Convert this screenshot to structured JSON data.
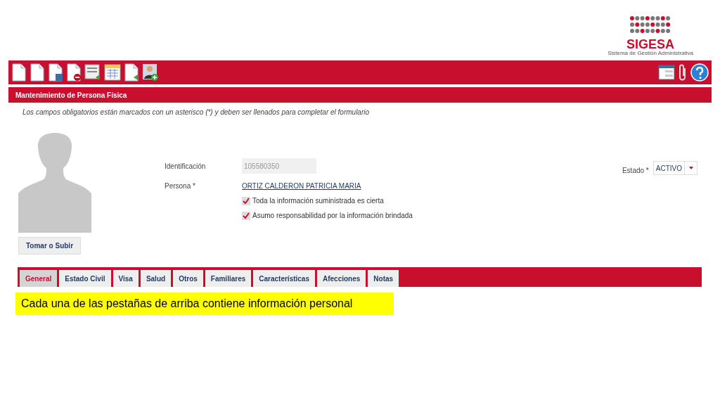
{
  "logo": {
    "name": "SIGESA",
    "subtitle": "Sistema de Gestión Administrativa"
  },
  "panel_title": "Mantenimiento de Persona Física",
  "instructions": "Los campos obligatorios están marcados con un asterisco (*) y deben ser llenados para completar el formulario",
  "photo_button": "Tomar o Subir",
  "form": {
    "id_label": "Identificación",
    "id_value": "105580350",
    "persona_label": "Persona *",
    "persona_link": "ORTIZ CALDERON PATRICIA MARIA",
    "checks": [
      {
        "label": "Toda la información suministrada es cierta",
        "checked": true
      },
      {
        "label": "Asumo responsabilidad por la información brindada",
        "checked": true
      }
    ],
    "estado_label": "Estado *",
    "estado_value": "ACTIVO"
  },
  "tabs": [
    {
      "label": "General",
      "selected": true
    },
    {
      "label": "Estado Civil",
      "selected": false
    },
    {
      "label": "Visa",
      "selected": false
    },
    {
      "label": "Salud",
      "selected": false
    },
    {
      "label": "Otros",
      "selected": false
    },
    {
      "label": "Familiares",
      "selected": false
    },
    {
      "label": "Características",
      "selected": false
    },
    {
      "label": "Afecciones",
      "selected": false
    },
    {
      "label": "Notas",
      "selected": false
    }
  ],
  "note": "Cada una de las pestañas de arriba contiene información personal"
}
